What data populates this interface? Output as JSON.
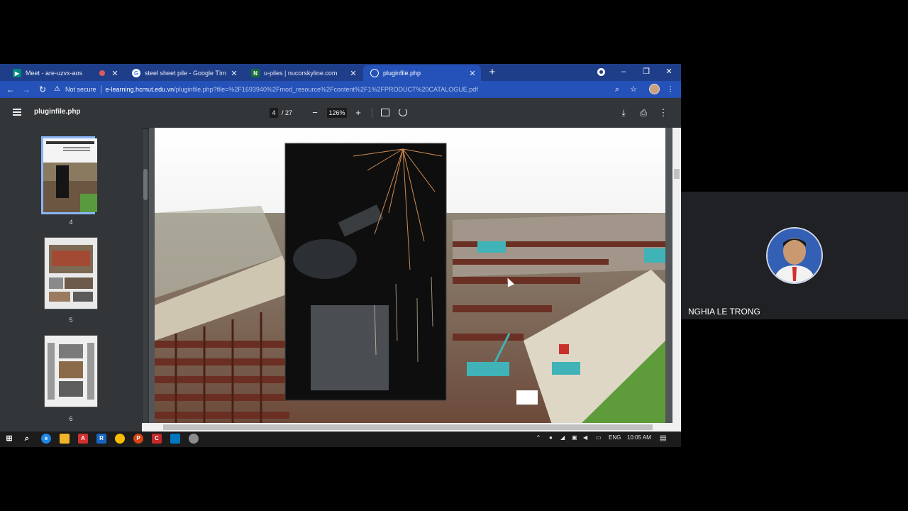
{
  "browser": {
    "tabs": [
      {
        "title": "Meet - are-uzvx-aos",
        "icon": "google-meet-icon"
      },
      {
        "title": "steel sheet pile - Google Tìm kiếm",
        "icon": "google-icon"
      },
      {
        "title": "u-piles | nucorskyline.com",
        "icon": "nucor-icon"
      },
      {
        "title": "pluginfile.php",
        "icon": "globe-icon"
      }
    ],
    "new_tab": "+",
    "window_controls": {
      "minimize": "–",
      "restore": "❐",
      "close": "✕"
    },
    "nav": {
      "back": "←",
      "forward": "→",
      "reload": "↻"
    },
    "address": {
      "security_label": "Not secure",
      "url_host": "e-learning.hcmut.edu.vn",
      "url_path": "/pluginfile.php?file=%2F1693940%2Fmod_resource%2Fcontent%2F1%2FPRODUCT%20CATALOGUE.pdf"
    }
  },
  "pdf": {
    "title": "pluginfile.php",
    "current_page": "4",
    "total_pages": "/ 27",
    "zoom": "126%",
    "zoom_out": "−",
    "zoom_in": "+",
    "thumbnails": [
      "4",
      "5",
      "6"
    ],
    "selected_thumbnail": "4"
  },
  "taskbar": {
    "language": "ENG",
    "time": "10:05 AM"
  },
  "meet": {
    "participant_name": "NGHIA LE TRONG"
  }
}
